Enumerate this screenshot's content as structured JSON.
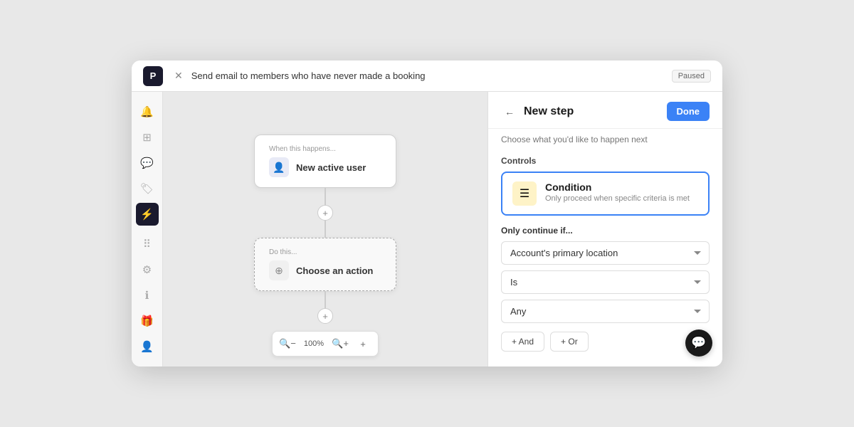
{
  "titleBar": {
    "logo": "P",
    "closeLabel": "✕",
    "title": "Send email to members who have never made a booking",
    "badge": "Paused"
  },
  "sidebar": {
    "icons": [
      {
        "name": "bell-icon",
        "symbol": "🔔",
        "active": false
      },
      {
        "name": "grid-icon",
        "symbol": "⊞",
        "active": false
      },
      {
        "name": "chat-icon",
        "symbol": "💬",
        "active": false
      },
      {
        "name": "tag-icon",
        "symbol": "🏷",
        "active": false
      },
      {
        "name": "bolt-icon",
        "symbol": "⚡",
        "active": true
      },
      {
        "name": "apps-icon",
        "symbol": "⠿",
        "active": false
      },
      {
        "name": "settings-icon",
        "symbol": "⚙",
        "active": false
      },
      {
        "name": "info-icon",
        "symbol": "ℹ",
        "active": false
      },
      {
        "name": "gift-icon",
        "symbol": "🎁",
        "active": false
      },
      {
        "name": "avatar-icon",
        "symbol": "👤",
        "active": false
      }
    ]
  },
  "canvas": {
    "triggerNode": {
      "labelSmall": "When this happens...",
      "iconSymbol": "👤",
      "title": "New active user"
    },
    "actionNode": {
      "labelSmall": "Do this...",
      "iconSymbol": "⊕",
      "title": "Choose an action"
    },
    "zoomLevel": "100%",
    "toolbar": {
      "zoomOutLabel": "−",
      "zoomInLabel": "+",
      "addLabel": "+"
    }
  },
  "panel": {
    "backLabel": "←",
    "title": "New step",
    "subtitle": "Choose what you'd like to happen next",
    "doneLabel": "Done",
    "controlsLabel": "Controls",
    "condition": {
      "iconSymbol": "☰",
      "title": "Condition",
      "description": "Only proceed when specific criteria is met"
    },
    "onlyContinueLabel": "Only continue if...",
    "dropdowns": [
      {
        "name": "location-dropdown",
        "value": "Account's primary location",
        "placeholder": "Account's primary location"
      },
      {
        "name": "operator-dropdown",
        "value": "Is",
        "placeholder": "Is"
      },
      {
        "name": "value-dropdown",
        "value": "Any",
        "placeholder": "Any"
      }
    ],
    "buttons": [
      {
        "name": "and-button",
        "label": "+ And"
      },
      {
        "name": "or-button",
        "label": "+ Or"
      }
    ]
  }
}
